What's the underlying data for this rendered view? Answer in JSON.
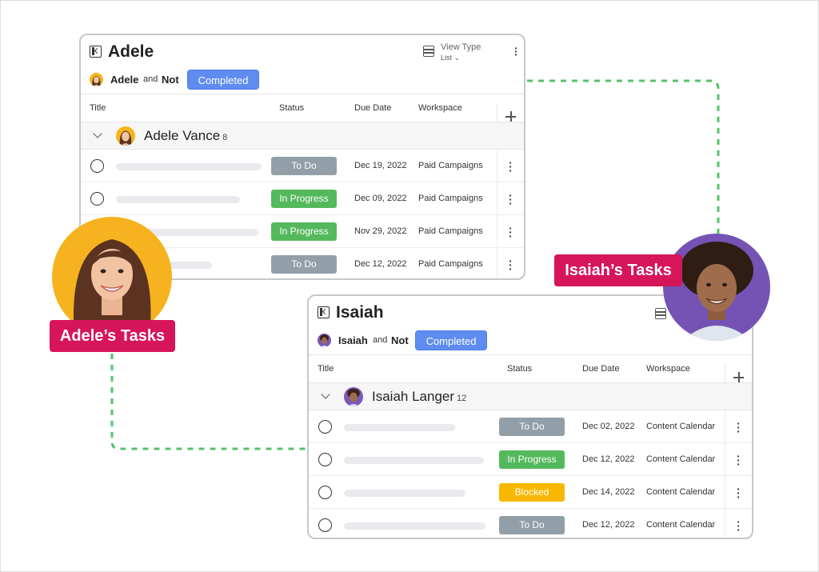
{
  "colors": {
    "completed": "#5f8cf0",
    "todo": "#929fa9",
    "in_progress": "#54b95c",
    "blocked": "#f9b800",
    "tag": "#d6155b",
    "connector": "#55c26a"
  },
  "cards": [
    {
      "title": "Adele",
      "view_type_label": "View Type",
      "view_type_value": "List",
      "filter": {
        "name": "Adele",
        "and": "and",
        "not": "Not",
        "status_button": "Completed"
      },
      "columns": {
        "title": "Title",
        "status": "Status",
        "due": "Due Date",
        "workspace": "Workspace"
      },
      "group": {
        "name": "Adele Vance",
        "count": "8"
      },
      "rows": [
        {
          "status": "To Do",
          "due": "Dec 19, 2022",
          "workspace": "Paid Campaigns"
        },
        {
          "status": "In Progress",
          "due": "Dec 09, 2022",
          "workspace": "Paid Campaigns"
        },
        {
          "status": "In Progress",
          "due": "Nov 29, 2022",
          "workspace": "Paid Campaigns"
        },
        {
          "status": "To Do",
          "due": "Dec 12, 2022",
          "workspace": "Paid Campaigns"
        }
      ]
    },
    {
      "title": "Isaiah",
      "filter": {
        "name": "Isaiah",
        "and": "and",
        "not": "Not",
        "status_button": "Completed"
      },
      "columns": {
        "title": "Title",
        "status": "Status",
        "due": "Due Date",
        "workspace": "Workspace"
      },
      "group": {
        "name": "Isaiah Langer",
        "count": "12"
      },
      "rows": [
        {
          "status": "To Do",
          "due": "Dec 02, 2022",
          "workspace": "Content Calendar"
        },
        {
          "status": "In Progress",
          "due": "Dec 12, 2022",
          "workspace": "Content Calendar"
        },
        {
          "status": "Blocked",
          "due": "Dec 14, 2022",
          "workspace": "Content Calendar"
        },
        {
          "status": "To Do",
          "due": "Dec 12, 2022",
          "workspace": "Content Calendar"
        }
      ]
    }
  ],
  "tags": {
    "adele": "Adele’s Tasks",
    "isaiah": "Isaiah’s Tasks"
  }
}
